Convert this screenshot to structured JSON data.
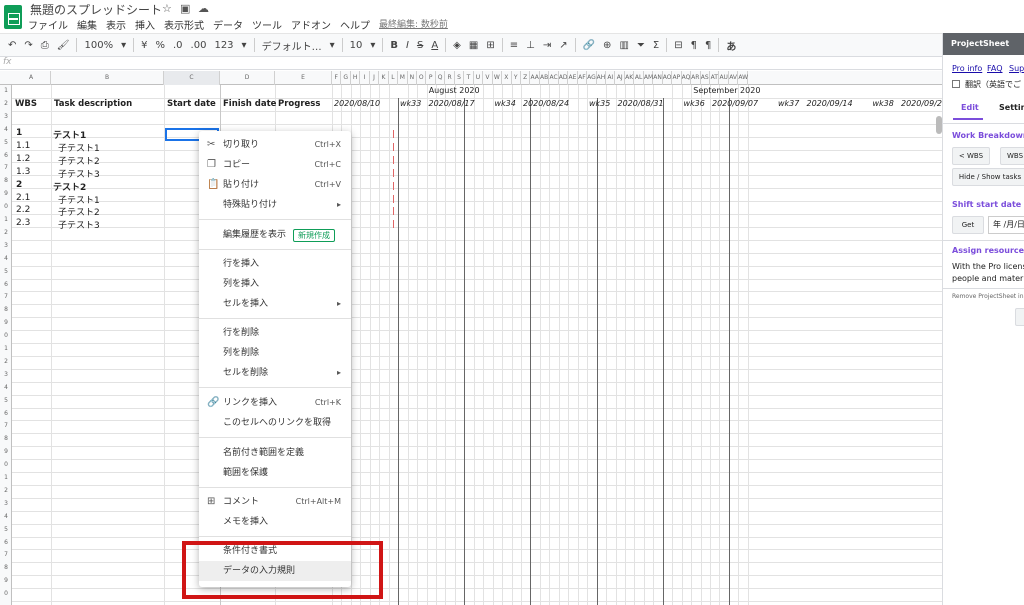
{
  "doc": {
    "title": "無題のスプレッドシート"
  },
  "menu": [
    "ファイル",
    "編集",
    "表示",
    "挿入",
    "表示形式",
    "データ",
    "ツール",
    "アドオン",
    "ヘルプ"
  ],
  "menu_last_edit": "最終編集: 数秒前",
  "toolbar": {
    "zoom": "100%",
    "currency": "¥",
    "percent": "%",
    "decimal_less": ".0",
    "decimal_more": ".00",
    "format_more": "123",
    "font": "デフォルト…",
    "font_size": "10",
    "bold": "B",
    "italic": "I",
    "strike": "S",
    "text_color": "A",
    "input_tools": "あ"
  },
  "columns": [
    {
      "id": "A",
      "header": "WBS"
    },
    {
      "id": "B",
      "header": "Task description"
    },
    {
      "id": "C",
      "header": "Start date"
    },
    {
      "id": "D",
      "header": "Finish date"
    },
    {
      "id": "E",
      "header": "Progress"
    }
  ],
  "gantt_cols": [
    "F",
    "G",
    "H",
    "I",
    "J",
    "K",
    "L",
    "M",
    "N",
    "O",
    "P",
    "Q",
    "R",
    "S",
    "T",
    "U",
    "V",
    "W",
    "X",
    "Y",
    "Z",
    "AA",
    "AB",
    "AC",
    "AD",
    "AE",
    "AF",
    "AG",
    "AH",
    "AI",
    "AJ",
    "AK",
    "AL",
    "AM",
    "AN",
    "AO",
    "AP",
    "AQ",
    "AR",
    "AS",
    "AT",
    "AU",
    "AV",
    "AW"
  ],
  "months": [
    "August 2020",
    "September 2020"
  ],
  "weeks": [
    {
      "date": "2020/08/10",
      "wk": "wk33"
    },
    {
      "date": "2020/08/17",
      "wk": "wk34"
    },
    {
      "date": "2020/08/24",
      "wk": "wk35"
    },
    {
      "date": "2020/08/31",
      "wk": "wk36"
    },
    {
      "date": "2020/09/07",
      "wk": "wk37"
    },
    {
      "date": "2020/09/14",
      "wk": "wk38"
    },
    {
      "date": "2020/09/2",
      "wk": ""
    }
  ],
  "tasks": [
    {
      "wbs": "1",
      "name": "テスト1",
      "bold": true
    },
    {
      "wbs": "1.1",
      "name": "子テスト1",
      "bold": false
    },
    {
      "wbs": "1.2",
      "name": "子テスト2",
      "bold": false
    },
    {
      "wbs": "1.3",
      "name": "子テスト3",
      "bold": false
    },
    {
      "wbs": "2",
      "name": "テスト2",
      "bold": true
    },
    {
      "wbs": "2.1",
      "name": "子テスト1",
      "bold": false
    },
    {
      "wbs": "2.2",
      "name": "子テスト2",
      "bold": false
    },
    {
      "wbs": "2.3",
      "name": "子テスト3",
      "bold": false
    }
  ],
  "context_menu": {
    "cut": {
      "label": "切り取り",
      "shortcut": "Ctrl+X"
    },
    "copy": {
      "label": "コピー",
      "shortcut": "Ctrl+C"
    },
    "paste": {
      "label": "貼り付け",
      "shortcut": "Ctrl+V"
    },
    "paste_special": {
      "label": "特殊貼り付け"
    },
    "edit_history": {
      "label": "編集履歴を表示",
      "badge": "新規作成"
    },
    "insert_row": {
      "label": "行を挿入"
    },
    "insert_col": {
      "label": "列を挿入"
    },
    "insert_cells": {
      "label": "セルを挿入"
    },
    "delete_row": {
      "label": "行を削除"
    },
    "delete_col": {
      "label": "列を削除"
    },
    "delete_cells": {
      "label": "セルを削除"
    },
    "insert_link": {
      "label": "リンクを挿入",
      "shortcut": "Ctrl+K"
    },
    "get_link": {
      "label": "このセルへのリンクを取得"
    },
    "named_range": {
      "label": "名前付き範囲を定義"
    },
    "protect_range": {
      "label": "範囲を保護"
    },
    "comment": {
      "label": "コメント",
      "shortcut": "Ctrl+Alt+M"
    },
    "insert_note": {
      "label": "メモを挿入"
    },
    "conditional_format": {
      "label": "条件付き書式"
    },
    "data_validation": {
      "label": "データの入力規則"
    }
  },
  "panel": {
    "title": "ProjectSheet",
    "links": [
      "Pro info",
      "FAQ",
      "Sup"
    ],
    "translate": "翻訳（英語でご",
    "tab_edit": "Edit",
    "tab_settings": "Setting",
    "wbs_title": "Work Breakdown S",
    "btn_wbs_less": "< WBS",
    "btn_wbs_more": "WBS",
    "btn_hide_show": "Hide / Show tasks",
    "shift_title": "Shift start date of ta",
    "btn_get": "Get",
    "date_input": "年 /月/日",
    "assign_title": "Assign resources",
    "assign_text1": "With the Pro license",
    "assign_text2": "people and material",
    "remove_text": "Remove ProjectSheet in"
  },
  "colors": {
    "accent_red": "#d01515",
    "panel_purple": "#7b4ddb",
    "sheets_green": "#0f9d58"
  }
}
